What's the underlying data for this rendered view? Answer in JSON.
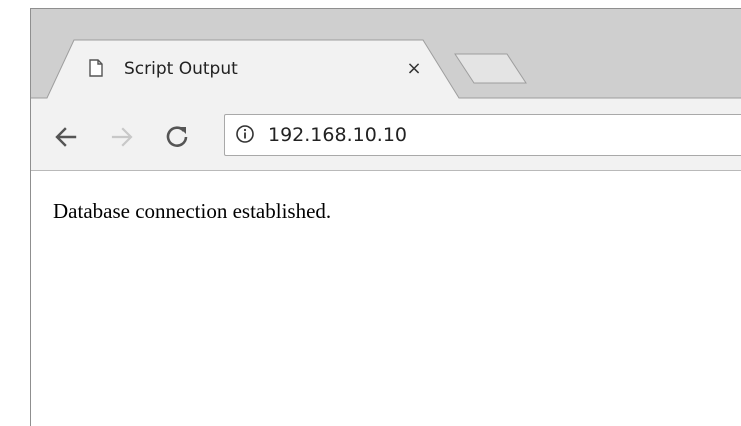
{
  "browser": {
    "tabs": [
      {
        "title": "Script Output",
        "icon": "page-icon",
        "close_label": "×",
        "active": true
      }
    ],
    "new_tab_icon": "new-tab-icon",
    "toolbar": {
      "back_icon": "back-arrow-icon",
      "forward_icon": "forward-arrow-icon",
      "reload_icon": "reload-icon",
      "address": {
        "security_icon": "info-icon",
        "url": "192.168.10.10"
      }
    }
  },
  "page": {
    "body_text": "Database connection established."
  },
  "colors": {
    "tabstrip": "#cfcfcf",
    "toolbar": "#f2f2f2",
    "active_tab": "#f2f2f2",
    "forward_disabled": "#c8c8c8"
  }
}
